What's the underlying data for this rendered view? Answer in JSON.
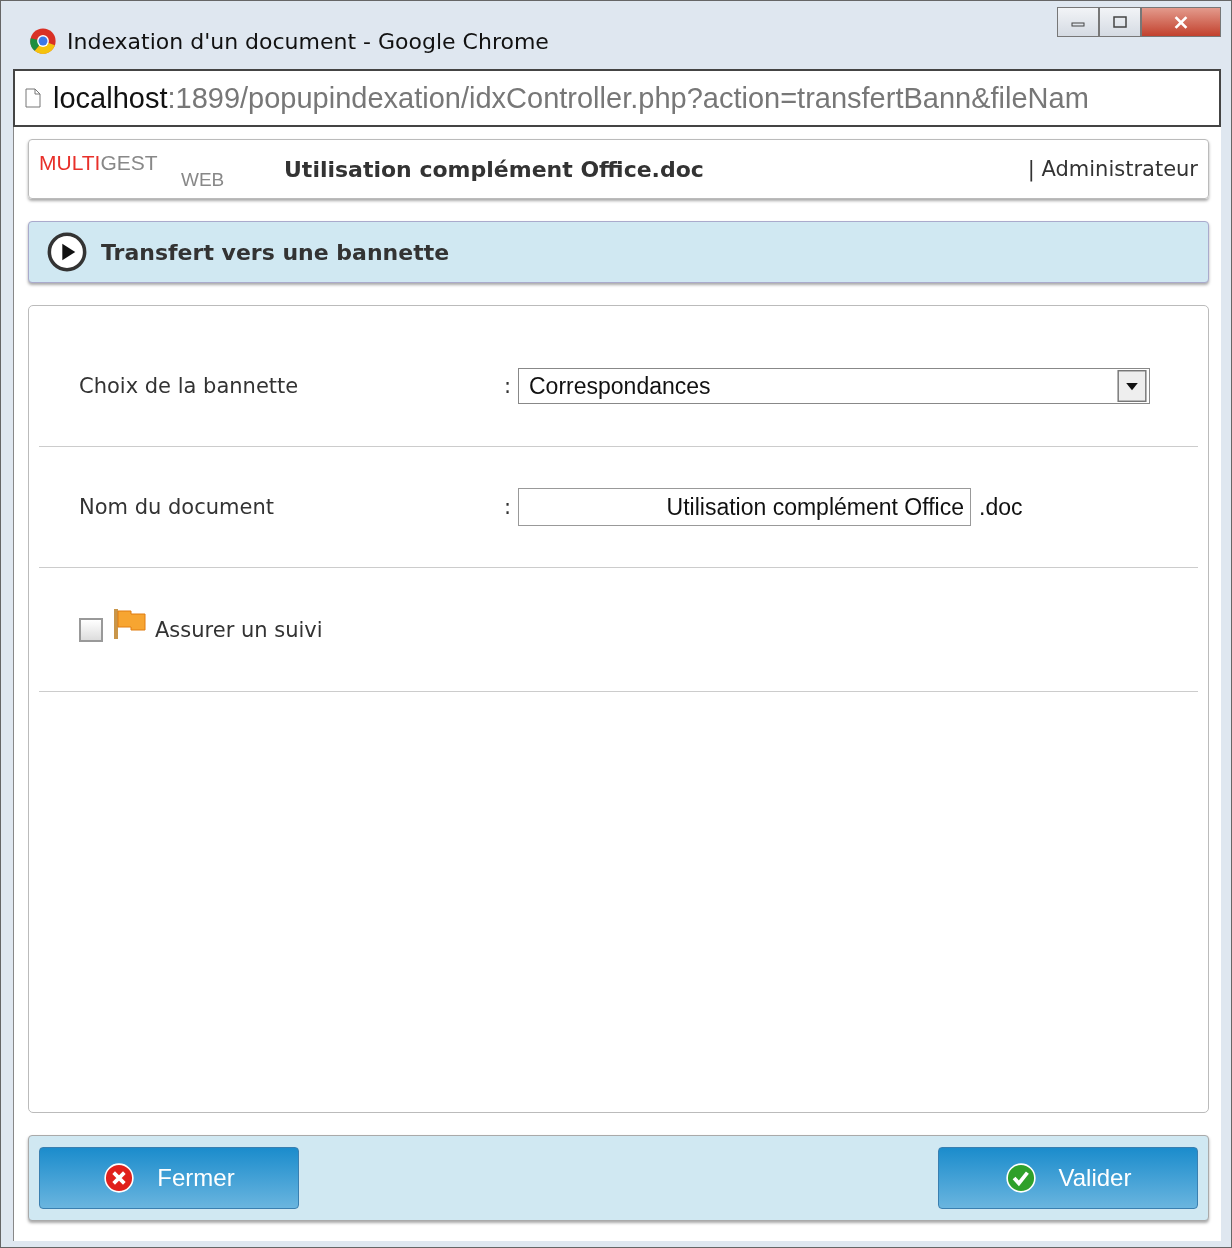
{
  "window": {
    "title": "Indexation d'un document - Google Chrome"
  },
  "address_bar": {
    "host": "localhost",
    "path": ":1899/popupindexation/idxController.php?action=transfertBann&fileNam"
  },
  "header": {
    "logo": [
      "MULTI",
      "GEST",
      "WEB"
    ],
    "document_title": "Utilisation complément Office.doc",
    "user": "| Administrateur"
  },
  "section": {
    "title": "Transfert vers une bannette"
  },
  "form": {
    "rows": [
      {
        "kind": "select",
        "label": "Choix de la bannette",
        "separator": ":",
        "value": "Correspondances"
      },
      {
        "kind": "text",
        "label": "Nom du document",
        "separator": ":",
        "value": "Utilisation complément Office",
        "suffix": ".doc"
      },
      {
        "kind": "checkbox",
        "label": "Assurer un suivi",
        "checked": false
      }
    ]
  },
  "buttons": [
    {
      "kind": "cancel",
      "label": "Fermer"
    },
    {
      "kind": "ok",
      "label": "Valider"
    }
  ]
}
